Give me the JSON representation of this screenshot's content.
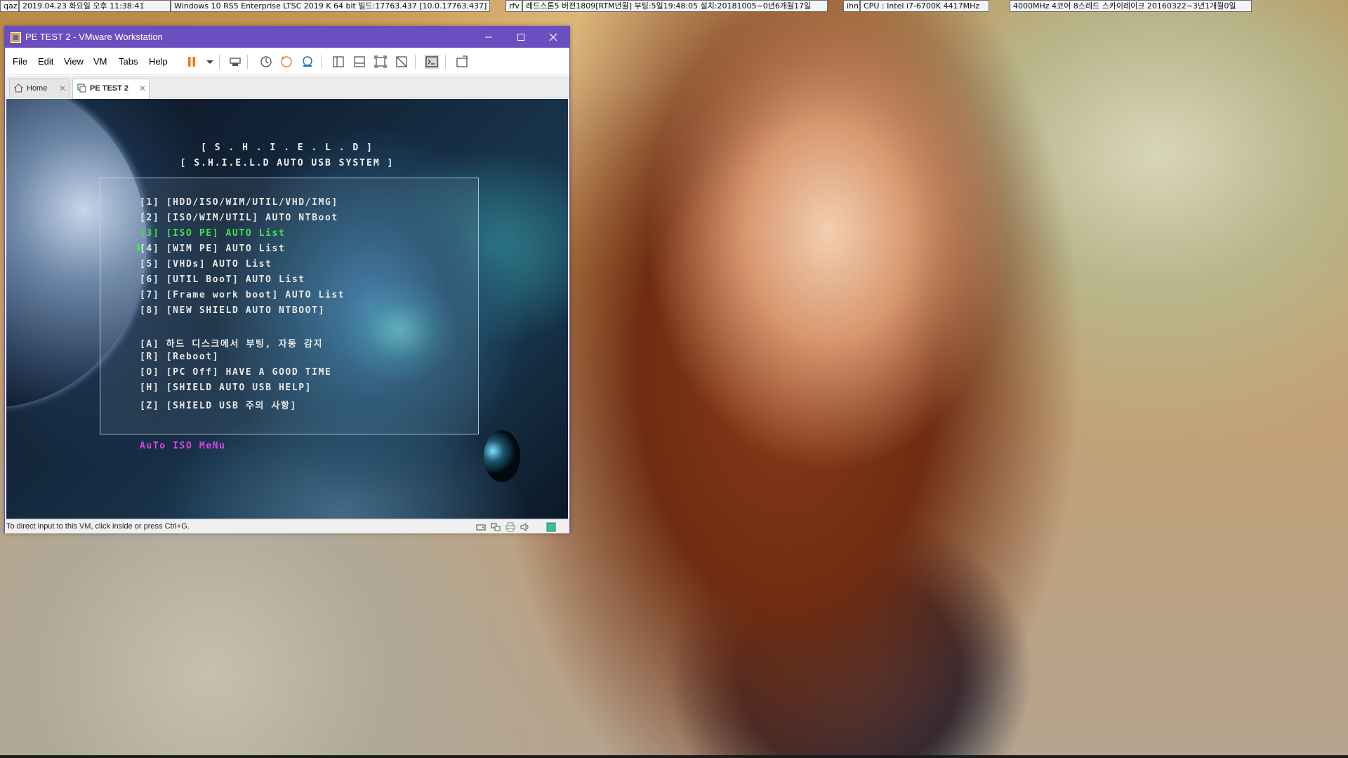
{
  "topbar": {
    "items": [
      "qaz",
      "2019.04.23 화요일 오후 11:38:41",
      "Windows 10 RS5 Enterprise LTSC 2019 K 64 bit 빌드:17763.437 [10.0.17763.437]",
      "rfv",
      "레드스톤5 버전1809[RTM년월] 부팅:5일19:48:05 설치:20181005~0년6개월17일",
      "ihn",
      "CPU : Intel i7-6700K 4417MHz",
      "4000MHz 4코어 8스레드 스카이레이크 20160322~3년1개월0일"
    ]
  },
  "window": {
    "title": "PE TEST 2 - VMware Workstation",
    "accent": "#6b4fc0",
    "controls": {
      "minimize": "—",
      "maximize": "☐",
      "close": "✕"
    }
  },
  "menu": {
    "file": "File",
    "edit": "Edit",
    "view": "View",
    "vm": "VM",
    "tabs": "Tabs",
    "help": "Help"
  },
  "toolbar": {
    "icons": [
      "pause-icon",
      "dropdown-icon",
      "send-ctrl-alt-del-icon",
      "snapshot-icon",
      "revert-snapshot-icon",
      "snapshot-manager-icon",
      "library-icon",
      "thumbnail-icon",
      "full-screen-icon",
      "unity-icon",
      "console-icon",
      "stretch-icon"
    ]
  },
  "tabs": [
    {
      "label": "Home",
      "icon": "home-icon",
      "active": false
    },
    {
      "label": "PE TEST 2",
      "icon": "vm-icon",
      "active": true
    }
  ],
  "vm_screen": {
    "title_line1": "[ S . H . I . E . L . D ]",
    "title_line2": "[ S.H.I.E.L.D AUTO USB SYSTEM ]",
    "menu_lines": [
      "[1] [HDD/ISO/WIM/UTIL/VHD/IMG]",
      "[2] [ISO/WIM/UTIL] AUTO NTBoot",
      "[3] [ISO PE] AUTO List",
      "[4] [WIM PE] AUTO List",
      "[5] [VHDs] AUTO List",
      "[6] [UTIL BooT] AUTO List",
      "[7] [Frame work boot] AUTO List",
      "[8] [NEW SHIELD AUTO NTBOOT]",
      "",
      "[A] 하드 디스크에서 부팅, 자동 감지",
      "[R] [Reboot]",
      "[O] [PC Off] HAVE A GOOD TIME",
      "[H] [SHIELD AUTO USB HELP]",
      "[Z] [SHIELD USB 주의 사항]"
    ],
    "selected_index": 2,
    "selected_color": "#3ee84a",
    "footer_label": "AuTo ISO MeNu",
    "footer_color": "#e040e8"
  },
  "statusbar": {
    "text": "To direct input to this VM, click inside or press Ctrl+G.",
    "icons": [
      "hard-disk-icon",
      "network-icon",
      "printer-icon",
      "sound-icon",
      "message-icon"
    ]
  }
}
